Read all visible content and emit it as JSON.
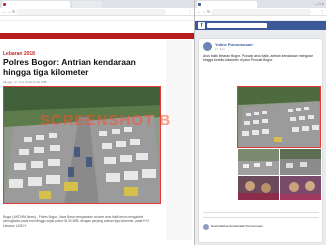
{
  "left": {
    "tab_title": "",
    "url": "",
    "site": {
      "logo": "",
      "nav_items": []
    },
    "article": {
      "kicker": "Lebaran 2018",
      "headline": "Polres Bogor: Antrian kendaraan hingga tiga kilometer",
      "byline": "Minggu, 17 Juni 2018 22:49 WIB",
      "caption": "Bogor (ANTARA News) - Polres Bogor, Jawa Barat menyatakan volume arus balik terus mengalami peningkatan pada hari Minggu sejak pukul 06.30 WIB, dengan panjang antrian tiga kilometer, pada H+2 Lebaran 1439 H."
    },
    "watermark": "SCREENSHOT B"
  },
  "right": {
    "tab_title": "",
    "url": "",
    "post": {
      "author": "Yuline Purnomosari",
      "time": "17 Juni",
      "text": "Arus balik lebaran Bogor. Puncak arus balik, antrian kendaraan mengular hingga berkilo-kilometer di jalur Puncak Bogor.",
      "reactions": "",
      "like": "",
      "comment": "",
      "share": "",
      "comment_preview": "Dewi Marlina Nurbarokah Purnomosari"
    }
  },
  "colors": {
    "news_red": "#b71c1c",
    "fb_blue": "#3b5998",
    "highlight_border": "#e53935"
  }
}
